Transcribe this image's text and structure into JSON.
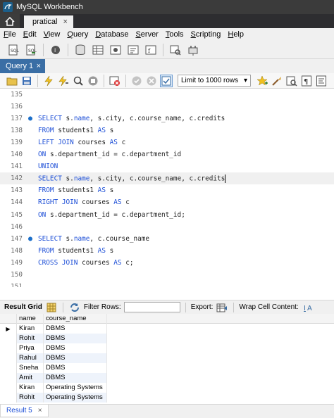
{
  "window": {
    "title": "MySQL Workbench"
  },
  "connection_tab": {
    "label": "pratical",
    "close": "×"
  },
  "menu": [
    {
      "key": "F",
      "rest": "ile"
    },
    {
      "key": "E",
      "rest": "dit"
    },
    {
      "key": "V",
      "rest": "iew"
    },
    {
      "key": "Q",
      "rest": "uery"
    },
    {
      "key": "D",
      "rest": "atabase"
    },
    {
      "key": "S",
      "rest": "erver"
    },
    {
      "key": "T",
      "rest": "ools"
    },
    {
      "key": "S",
      "rest": "cripting"
    },
    {
      "key": "H",
      "rest": "elp"
    }
  ],
  "query_tab": {
    "label": "Query 1",
    "close": "×"
  },
  "editor_toolbar": {
    "limit_label": "Limit to 1000 rows"
  },
  "editor": {
    "lines": [
      {
        "num": "135",
        "marker": "",
        "segments": []
      },
      {
        "num": "136",
        "marker": "",
        "segments": []
      },
      {
        "num": "137",
        "marker": "●",
        "segments": [
          {
            "t": "SELECT",
            "k": true
          },
          {
            "t": " s."
          },
          {
            "t": "name",
            "k": true
          },
          {
            "t": ", s.city, c.course_name, c.credits"
          }
        ]
      },
      {
        "num": "138",
        "marker": "",
        "segments": [
          {
            "t": "FROM",
            "k": true
          },
          {
            "t": " students1 "
          },
          {
            "t": "AS",
            "k": true
          },
          {
            "t": " s"
          }
        ]
      },
      {
        "num": "139",
        "marker": "",
        "segments": [
          {
            "t": "LEFT JOIN",
            "k": true
          },
          {
            "t": " courses "
          },
          {
            "t": "AS",
            "k": true
          },
          {
            "t": " c"
          }
        ]
      },
      {
        "num": "140",
        "marker": "",
        "segments": [
          {
            "t": "ON",
            "k": true
          },
          {
            "t": " s.department_id = c.department_id"
          }
        ]
      },
      {
        "num": "141",
        "marker": "",
        "segments": [
          {
            "t": "UNION",
            "k": true
          }
        ]
      },
      {
        "num": "142",
        "marker": "",
        "current": true,
        "segments": [
          {
            "t": "SELECT",
            "k": true
          },
          {
            "t": " s."
          },
          {
            "t": "name",
            "k": true
          },
          {
            "t": ", s.city, c.course_name, c.credits"
          }
        ]
      },
      {
        "num": "143",
        "marker": "",
        "segments": [
          {
            "t": "FROM",
            "k": true
          },
          {
            "t": " students1 "
          },
          {
            "t": "AS",
            "k": true
          },
          {
            "t": " s"
          }
        ]
      },
      {
        "num": "144",
        "marker": "",
        "segments": [
          {
            "t": "RIGHT JOIN",
            "k": true
          },
          {
            "t": " courses "
          },
          {
            "t": "AS",
            "k": true
          },
          {
            "t": " c"
          }
        ]
      },
      {
        "num": "145",
        "marker": "",
        "segments": [
          {
            "t": "ON",
            "k": true
          },
          {
            "t": " s.department_id = c.department_id;"
          }
        ]
      },
      {
        "num": "146",
        "marker": "",
        "segments": []
      },
      {
        "num": "147",
        "marker": "●",
        "segments": [
          {
            "t": "SELECT",
            "k": true
          },
          {
            "t": " s."
          },
          {
            "t": "name",
            "k": true
          },
          {
            "t": ", c.course_name"
          }
        ]
      },
      {
        "num": "148",
        "marker": "",
        "segments": [
          {
            "t": "FROM",
            "k": true
          },
          {
            "t": " students1 "
          },
          {
            "t": "AS",
            "k": true
          },
          {
            "t": " s"
          }
        ]
      },
      {
        "num": "149",
        "marker": "",
        "segments": [
          {
            "t": "CROSS JOIN",
            "k": true
          },
          {
            "t": " courses "
          },
          {
            "t": "AS",
            "k": true
          },
          {
            "t": " c;"
          }
        ]
      },
      {
        "num": "150",
        "marker": "",
        "segments": []
      },
      {
        "num": "151",
        "marker": "",
        "segments": []
      }
    ]
  },
  "result_toolbar": {
    "result_grid": "Result Grid",
    "filter_rows": "Filter Rows:",
    "export": "Export:",
    "wrap": "Wrap Cell Content:"
  },
  "grid": {
    "columns": [
      "name",
      "course_name"
    ],
    "rows": [
      [
        "Kiran",
        "DBMS"
      ],
      [
        "Rohit",
        "DBMS"
      ],
      [
        "Priya",
        "DBMS"
      ],
      [
        "Rahul",
        "DBMS"
      ],
      [
        "Sneha",
        "DBMS"
      ],
      [
        "Amit",
        "DBMS"
      ],
      [
        "Kiran",
        "Operating Systems"
      ],
      [
        "Rohit",
        "Operating Systems"
      ]
    ]
  },
  "result_tab": {
    "label": "Result 5",
    "close": "×"
  }
}
